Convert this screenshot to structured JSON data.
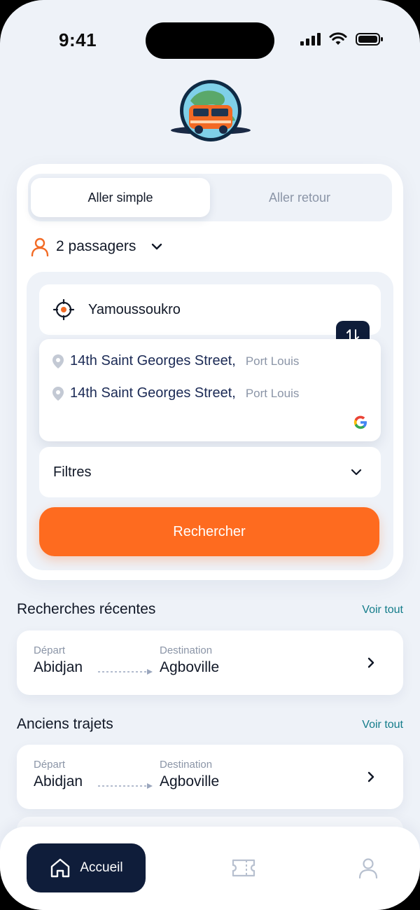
{
  "status_bar": {
    "time": "9:41"
  },
  "trip_type": {
    "one_way": "Aller simple",
    "round_trip": "Aller retour"
  },
  "passengers": {
    "label": "2 passagers"
  },
  "origin": {
    "city": "Yamoussoukro"
  },
  "suggestions": [
    {
      "street": "14th Saint Georges Street,",
      "town": "Port Louis"
    },
    {
      "street": "14th Saint Georges Street,",
      "town": "Port Louis"
    }
  ],
  "filters": {
    "label": "Filtres"
  },
  "search": {
    "button_label": "Rechercher"
  },
  "recent_searches": {
    "title": "Recherches récentes",
    "see_all": "Voir tout",
    "items": [
      {
        "departure_label": "Départ",
        "departure": "Abidjan",
        "destination_label": "Destination",
        "destination": "Agboville"
      }
    ]
  },
  "past_trips": {
    "title": "Anciens trajets",
    "see_all": "Voir tout",
    "items": [
      {
        "departure_label": "Départ",
        "departure": "Abidjan",
        "destination_label": "Destination",
        "destination": "Agboville"
      }
    ]
  },
  "bottom_nav": {
    "home_label": "Accueil"
  },
  "colors": {
    "accent": "#fe6b1f",
    "navy": "#0f1d3a",
    "link": "#137c8a",
    "background": "#eef2f8"
  },
  "icons": [
    "signal-icon",
    "wifi-icon",
    "battery-icon",
    "user-icon",
    "chevron-down-icon",
    "crosshair-icon",
    "swap-icon",
    "location-pin-icon",
    "google-icon",
    "chevron-right-icon",
    "home-icon",
    "ticket-icon",
    "profile-icon"
  ]
}
